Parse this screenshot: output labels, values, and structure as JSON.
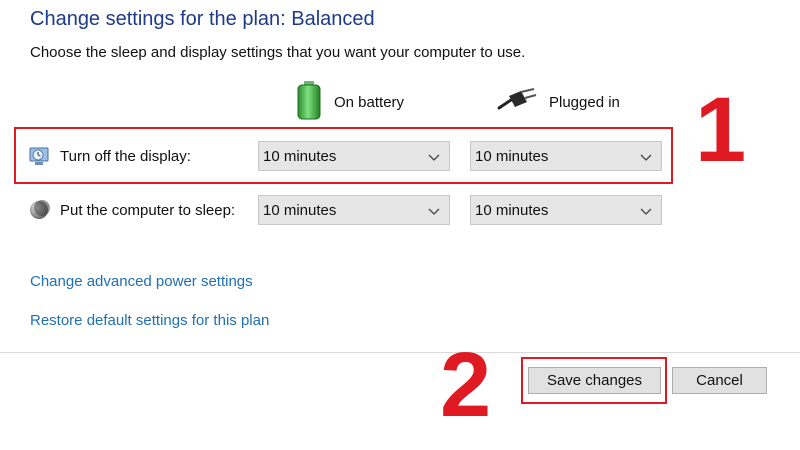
{
  "header": {
    "title": "Change settings for the plan: Balanced",
    "subtitle": "Choose the sleep and display settings that you want your computer to use."
  },
  "columns": {
    "on_battery": {
      "label": "On battery",
      "icon": "battery-icon"
    },
    "plugged_in": {
      "label": "Plugged in",
      "icon": "power-plug-icon"
    }
  },
  "settings": [
    {
      "label": "Turn off the display:",
      "icon": "display-icon",
      "on_battery": "10 minutes",
      "plugged_in": "10 minutes"
    },
    {
      "label": "Put the computer to sleep:",
      "icon": "sleep-moon-icon",
      "on_battery": "10 minutes",
      "plugged_in": "10 minutes"
    }
  ],
  "links": {
    "advanced": "Change advanced power settings",
    "restore": "Restore default settings for this plan"
  },
  "buttons": {
    "save": "Save changes",
    "cancel": "Cancel"
  },
  "annotations": {
    "marker_1": "1",
    "marker_2": "2"
  },
  "colors": {
    "title": "#1e3a8a",
    "link": "#1f6fb6",
    "highlight": "#e01a22"
  }
}
